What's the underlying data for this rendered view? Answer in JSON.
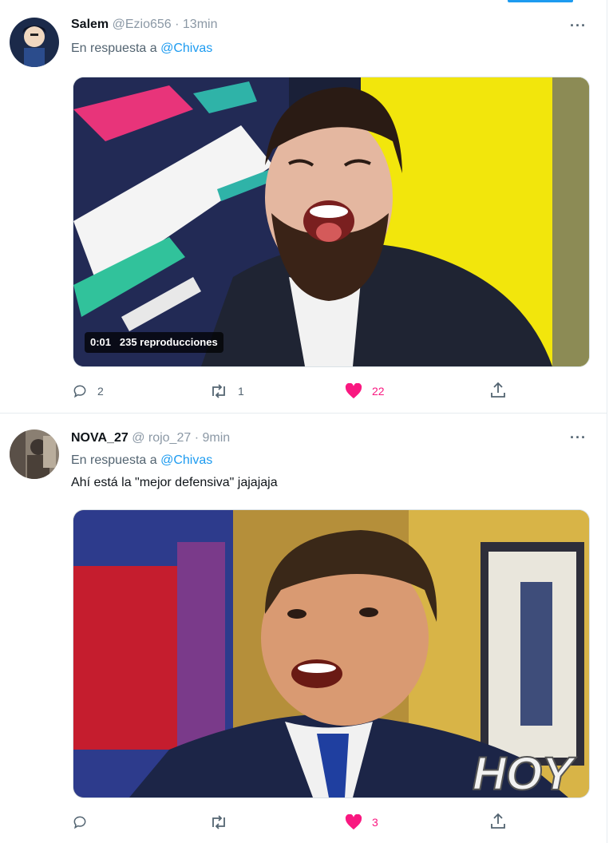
{
  "tweets": [
    {
      "name": "Salem",
      "handle": "@Ezio656",
      "time": "13min",
      "reply_prefix": "En respuesta a",
      "reply_mention": "@Chivas",
      "text": "",
      "video_time": "0:01",
      "video_views": "235 reproducciones",
      "actions": {
        "replies": "2",
        "retweets": "1",
        "likes": "22"
      }
    },
    {
      "name": "NOVA_27",
      "handle": "@ rojo_27",
      "time": "9min",
      "reply_prefix": "En respuesta a",
      "reply_mention": "@Chivas",
      "text": "Ahí está la \"mejor defensiva\" jajajaja",
      "media_watermark": "HOY",
      "actions": {
        "replies": "",
        "retweets": "",
        "likes": "3"
      }
    }
  ],
  "icons": {
    "more": "more-icon",
    "reply": "reply-icon",
    "retweet": "retweet-icon",
    "like": "heart-icon",
    "share": "share-icon"
  },
  "colors": {
    "accent": "#1d9bf0",
    "like": "#f91880",
    "muted": "#536471"
  }
}
